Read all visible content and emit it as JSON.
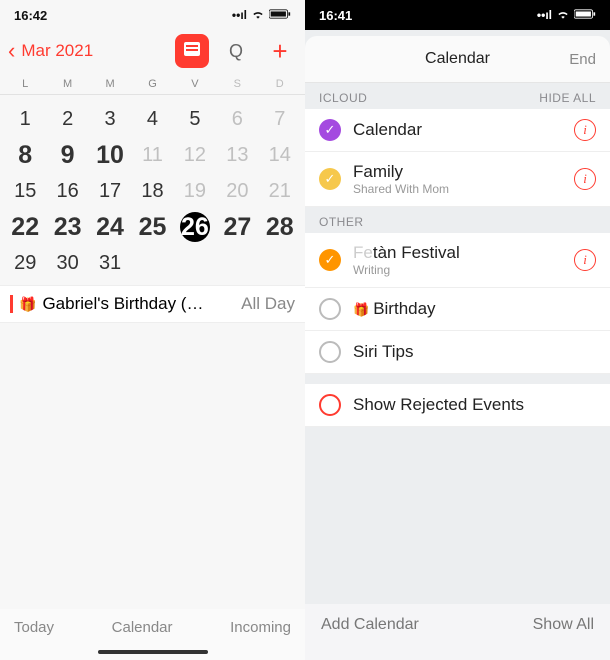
{
  "left": {
    "status_time": "16:42",
    "month": "Mar 2021",
    "weekdays": [
      "L",
      "M",
      "M",
      "G",
      "V",
      "S",
      "D"
    ],
    "weeks": [
      [
        {
          "n": "1"
        },
        {
          "n": "2"
        },
        {
          "n": "3"
        },
        {
          "n": "4"
        },
        {
          "n": "5"
        },
        {
          "n": "6",
          "dim": true
        },
        {
          "n": "7",
          "dim": true
        }
      ],
      [
        {
          "n": "8",
          "big": true
        },
        {
          "n": "9",
          "big": true
        },
        {
          "n": "10",
          "big": true
        },
        {
          "n": "11",
          "dim": true
        },
        {
          "n": "12",
          "dim": true
        },
        {
          "n": "13",
          "dim": true
        },
        {
          "n": "14",
          "dim": true
        }
      ],
      [
        {
          "n": "15"
        },
        {
          "n": "16"
        },
        {
          "n": "17"
        },
        {
          "n": "18"
        },
        {
          "n": "19",
          "dim": true
        },
        {
          "n": "20",
          "dim": true
        },
        {
          "n": "21",
          "dim": true
        }
      ],
      [
        {
          "n": "22",
          "big": true
        },
        {
          "n": "23",
          "big": true
        },
        {
          "n": "24",
          "big": true
        },
        {
          "n": "25",
          "big": true
        },
        {
          "n": "26",
          "big": true,
          "today": true
        },
        {
          "n": "27",
          "big": true
        },
        {
          "n": "28",
          "big": true
        }
      ],
      [
        {
          "n": "29"
        },
        {
          "n": "30"
        },
        {
          "n": "31"
        },
        {
          "n": ""
        },
        {
          "n": ""
        },
        {
          "n": ""
        },
        {
          "n": ""
        }
      ]
    ],
    "event_title": "Gabriel's Birthday (…",
    "event_allday": "All Day",
    "footer": {
      "today": "Today",
      "calendar": "Calendar",
      "incoming": "Incoming"
    }
  },
  "right": {
    "status_time": "16:41",
    "sheet_title": "Calendar",
    "sheet_end": "End",
    "section_icloud": "ICLOUD",
    "hide_all": "HIDE ALL",
    "icloud_items": [
      {
        "title": "Calendar",
        "sub": "",
        "check": "purple",
        "info": true
      },
      {
        "title": "Family",
        "sub": "Shared With Mom",
        "check": "yellow",
        "info": true
      }
    ],
    "section_other": "OTHER",
    "other_items": [
      {
        "title": "tàn Festival",
        "sub": "Writing",
        "prefix": "Fe",
        "check": "orange",
        "info": true
      },
      {
        "title": "Birthday",
        "sub": "",
        "gift": true,
        "check": "hollow",
        "info": false
      },
      {
        "title": "Siri Tips",
        "sub": "",
        "check": "hollow",
        "info": false
      }
    ],
    "rejected": "Show Rejected Events",
    "footer": {
      "add": "Add Calendar",
      "showall": "Show All"
    }
  }
}
